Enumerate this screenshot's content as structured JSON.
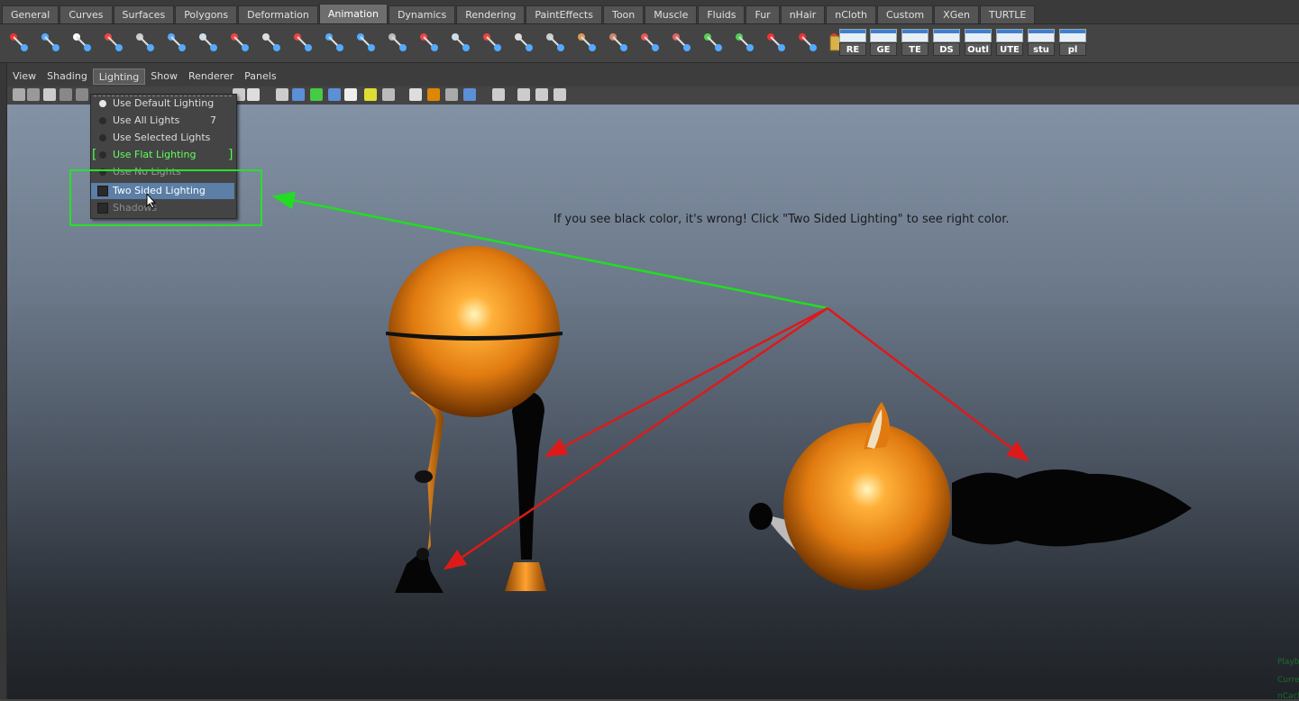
{
  "shelf_tabs": [
    "General",
    "Curves",
    "Surfaces",
    "Polygons",
    "Deformation",
    "Animation",
    "Dynamics",
    "Rendering",
    "PaintEffects",
    "Toon",
    "Muscle",
    "Fluids",
    "Fur",
    "nHair",
    "nCloth",
    "Custom",
    "XGen",
    "TURTLE"
  ],
  "active_shelf_tab": "Animation",
  "shelf_buttons": [
    "RE",
    "GE",
    "TE",
    "DS",
    "Outl",
    "UTE",
    "stu",
    "pl"
  ],
  "panel_menu": [
    "View",
    "Shading",
    "Lighting",
    "Show",
    "Renderer",
    "Panels"
  ],
  "open_menu": "Lighting",
  "lighting_menu": {
    "items": [
      {
        "label": "Use Default Lighting",
        "type": "radio",
        "selected": true
      },
      {
        "label": "Use All Lights",
        "type": "radio",
        "shortcut": "7"
      },
      {
        "label": "Use Selected Lights",
        "type": "radio"
      },
      {
        "label": "Use Flat Lighting",
        "type": "radio",
        "highlight": "green"
      },
      {
        "label": "Use No Lights",
        "type": "radio"
      },
      {
        "label": "Two Sided Lighting",
        "type": "checkbox",
        "hovered": true
      },
      {
        "label": "Shadows",
        "type": "checkbox",
        "disabled": true
      }
    ]
  },
  "annotation": {
    "note": "If you see black color, it's wrong! Click \"Two Sided Lighting\" to see right color.",
    "box_color": "#29e029",
    "arrow_green": "#22dd22",
    "arrow_red": "#dd1a1a"
  },
  "hud_lines": [
    "Playb",
    "Curre",
    "nCach"
  ],
  "colors": {
    "object_orange": "#e07a10",
    "highlight_blue": "#5b7fa6",
    "viewport_top": "#8392a5",
    "viewport_bottom": "#1e2226"
  }
}
